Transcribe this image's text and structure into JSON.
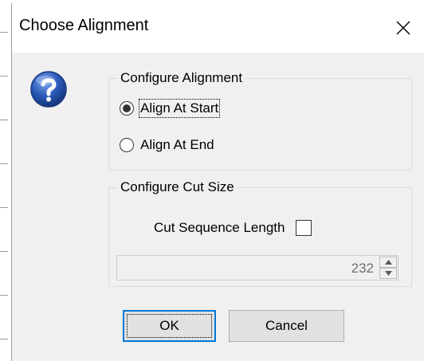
{
  "dialog": {
    "title": "Choose Alignment",
    "close_icon": "close-icon",
    "status_icon": "question-icon"
  },
  "alignment_group": {
    "title": "Configure Alignment",
    "options": [
      {
        "label": "Align At Start",
        "selected": true
      },
      {
        "label": "Align At End",
        "selected": false
      }
    ]
  },
  "cut_group": {
    "title": "Configure Cut Size",
    "checkbox_label": "Cut Sequence Length",
    "checkbox_checked": false,
    "spin_value": "232",
    "spin_enabled": false
  },
  "buttons": {
    "ok_label": "OK",
    "cancel_label": "Cancel"
  },
  "colors": {
    "accent": "#0078d7",
    "dialog_bg": "#f0f0f0",
    "icon_blue": "#2a5bb8"
  }
}
